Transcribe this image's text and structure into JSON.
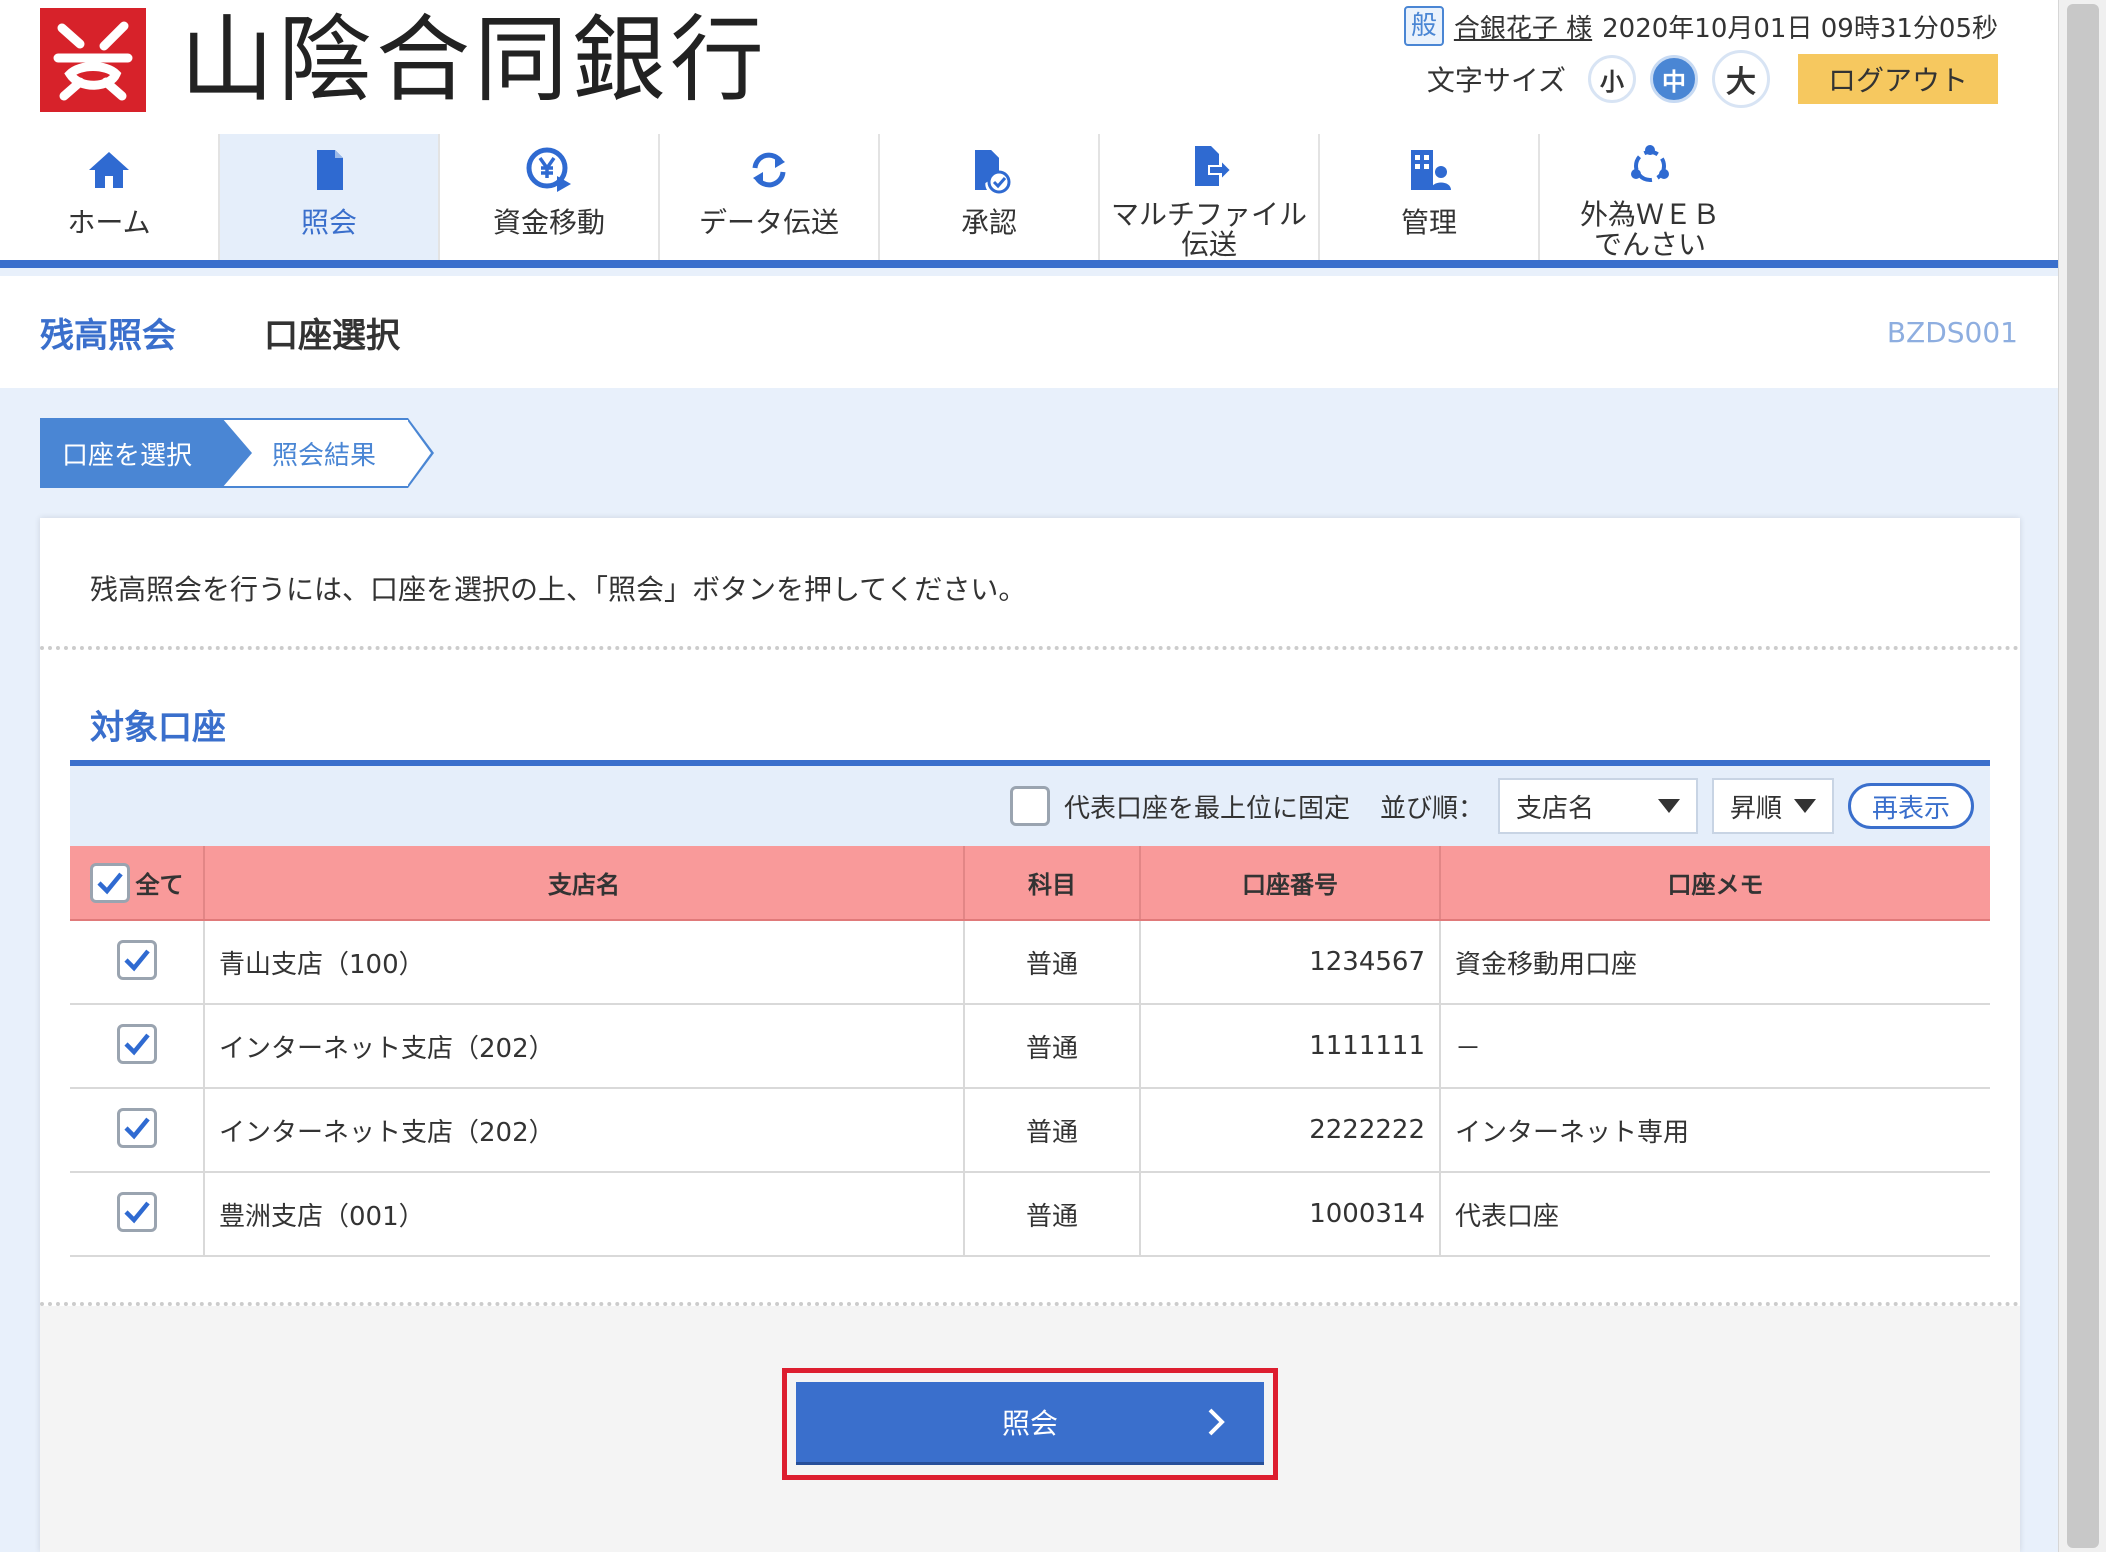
{
  "header": {
    "bank_name": "山陰合同銀行",
    "user_badge": "般",
    "user_name": "合銀花子 様",
    "timestamp": "2020年10月01日 09時31分05秒",
    "fontsize_label": "文字サイズ",
    "fontsize_small": "小",
    "fontsize_medium": "中",
    "fontsize_large": "大",
    "logout_label": "ログアウト"
  },
  "nav": {
    "items": [
      {
        "label": "ホーム",
        "icon": "home-icon"
      },
      {
        "label": "照会",
        "icon": "document-icon",
        "active": true
      },
      {
        "label": "資金移動",
        "icon": "yen-transfer-icon"
      },
      {
        "label": "データ伝送",
        "icon": "refresh-icon"
      },
      {
        "label": "承認",
        "icon": "approve-icon"
      },
      {
        "label": "マルチファイル伝送",
        "label_line1": "マルチファイル",
        "label_line2": "伝送",
        "icon": "multi-file-icon"
      },
      {
        "label": "管理",
        "icon": "admin-icon"
      },
      {
        "label": "外為ＷＥＢでんさい",
        "label_line1": "外為ＷＥＢ",
        "label_line2": "でんさい",
        "icon": "forex-icon"
      }
    ]
  },
  "titlebar": {
    "main_title": "残高照会",
    "sub_title": "口座選択",
    "screen_id": "BZDS001"
  },
  "steps": {
    "step1": "口座を選択",
    "step2": "照会結果"
  },
  "panel": {
    "instruction": "残高照会を行うには、口座を選択の上、「照会」ボタンを押してください。",
    "section_title": "対象口座",
    "pin_rep_label": "代表口座を最上位に固定",
    "sort_label": "並び順：",
    "sort_field": "支店名",
    "sort_order": "昇順",
    "redisplay_label": "再表示",
    "columns": {
      "all": "全て",
      "branch": "支店名",
      "subject": "科目",
      "account_no": "口座番号",
      "memo": "口座メモ"
    },
    "rows": [
      {
        "branch": "青山支店（100）",
        "subject": "普通",
        "account_no": "1234567",
        "memo": "資金移動用口座",
        "checked": true
      },
      {
        "branch": "インターネット支店（202）",
        "subject": "普通",
        "account_no": "1111111",
        "memo": "－",
        "checked": true
      },
      {
        "branch": "インターネット支店（202）",
        "subject": "普通",
        "account_no": "2222222",
        "memo": "インターネット専用",
        "checked": true
      },
      {
        "branch": "豊洲支店（001）",
        "subject": "普通",
        "account_no": "1000314",
        "memo": "代表口座",
        "checked": true
      }
    ],
    "submit_label": "照会"
  },
  "colors": {
    "brand_blue": "#3a6fcc",
    "header_row_pink": "#f99a9a",
    "logo_red": "#d7222a",
    "logout_yellow": "#f6c85f",
    "highlight_red": "#dd1e2f"
  }
}
